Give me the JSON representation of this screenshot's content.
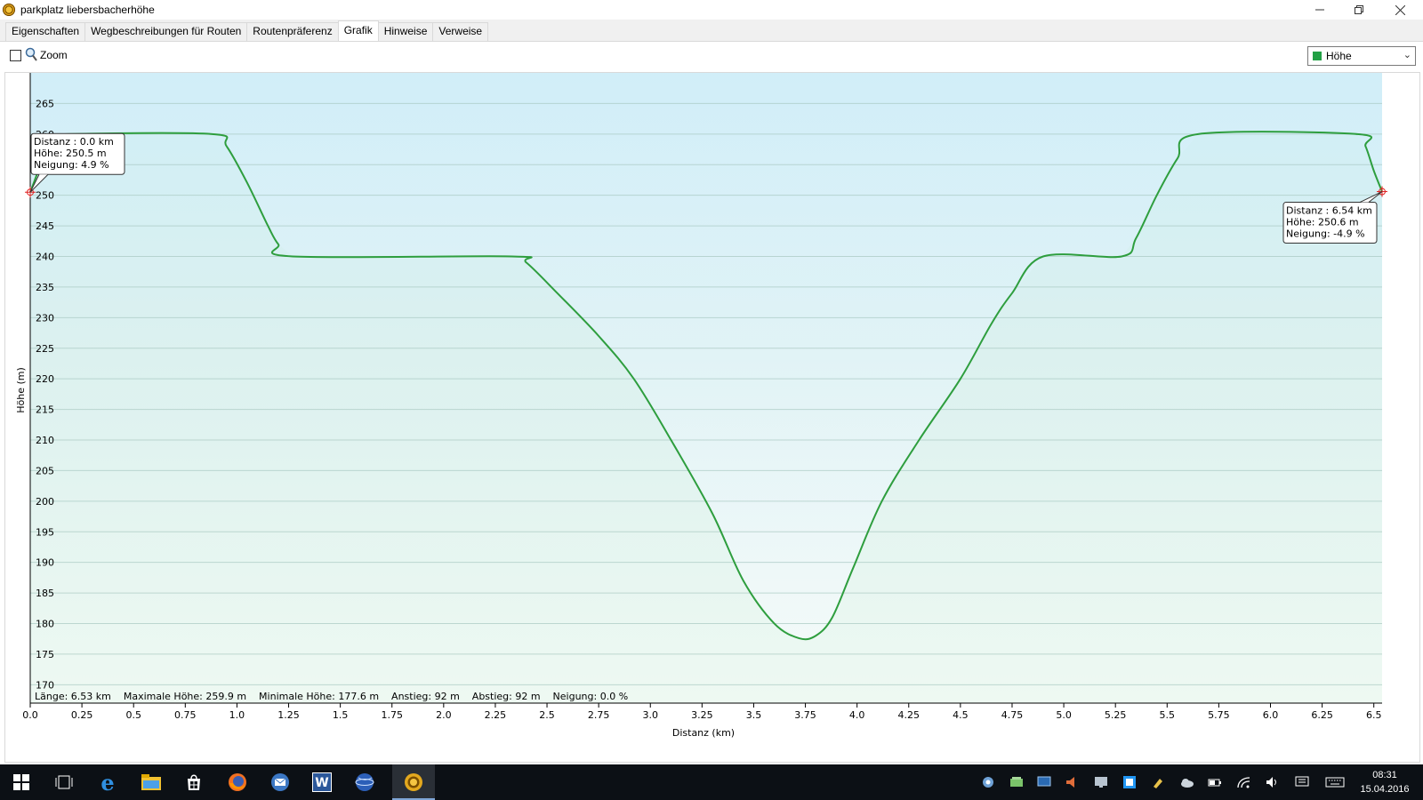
{
  "window": {
    "title": "parkplatz liebersbacherhöhe"
  },
  "tabs": [
    {
      "label": "Eigenschaften",
      "active": false
    },
    {
      "label": "Wegbeschreibungen für Routen",
      "active": false
    },
    {
      "label": "Routenpräferenz",
      "active": false
    },
    {
      "label": "Grafik",
      "active": true
    },
    {
      "label": "Hinweise",
      "active": false
    },
    {
      "label": "Verweise",
      "active": false
    }
  ],
  "toolbar": {
    "zoom_label": "Zoom",
    "zoom_checked": false,
    "series_select": {
      "value": "Höhe",
      "color": "#22a045"
    }
  },
  "chart_data": {
    "type": "area",
    "title": "",
    "xlabel": "Distanz  (km)",
    "ylabel": "Höhe (m)",
    "xlim": [
      0,
      6.54
    ],
    "ylim": [
      167,
      270
    ],
    "grid": true,
    "legend": "none",
    "line_color": "#2e9e3e",
    "x_ticks": [
      "0.0",
      "0.25",
      "0.5",
      "0.75",
      "1.0",
      "1.25",
      "1.5",
      "1.75",
      "2.0",
      "2.25",
      "2.5",
      "2.75",
      "3.0",
      "3.25",
      "3.5",
      "3.75",
      "4.0",
      "4.25",
      "4.5",
      "4.75",
      "5.0",
      "5.25",
      "5.5",
      "5.75",
      "6.0",
      "6.25",
      "6.5"
    ],
    "y_ticks": [
      "265",
      "260",
      "255",
      "250",
      "245",
      "240",
      "235",
      "230",
      "225",
      "220",
      "215",
      "210",
      "205",
      "200",
      "195",
      "190",
      "185",
      "180",
      "175",
      "170"
    ],
    "series": [
      {
        "x": [
          0.0,
          0.08,
          0.12,
          0.18,
          0.88,
          0.95,
          1.05,
          1.15,
          1.2,
          1.27,
          2.33,
          2.4,
          2.55,
          2.75,
          2.92,
          3.1,
          3.3,
          3.45,
          3.6,
          3.72,
          3.8,
          3.88,
          3.98,
          4.12,
          4.3,
          4.5,
          4.65,
          4.75,
          4.9,
          5.28,
          5.35,
          5.45,
          5.55,
          5.65,
          6.42,
          6.46,
          6.5,
          6.54
        ],
        "values": [
          250.5,
          257.5,
          259.5,
          260.0,
          260.0,
          258.0,
          252.0,
          245.0,
          242.0,
          240.0,
          240.0,
          239.0,
          234.0,
          227.0,
          220.0,
          210.0,
          198.0,
          187.0,
          180.0,
          177.6,
          178.0,
          181.0,
          189.0,
          200.0,
          210.0,
          220.0,
          229.0,
          234.0,
          240.0,
          240.0,
          243.0,
          250.0,
          256.0,
          260.0,
          260.0,
          258.0,
          254.0,
          250.6
        ]
      }
    ],
    "summary": "Länge: 6.53 km    Maximale Höhe: 259.9 m    Minimale Höhe: 177.6 m    Anstieg: 92 m    Abstieg: 92 m    Neigung: 0.0 %",
    "annotations": [
      {
        "x": 0.0,
        "y": 250.5,
        "lines": [
          "Distanz  : 0.0 km",
          "Höhe: 250.5 m",
          "Neigung: 4.9 %"
        ]
      },
      {
        "x": 6.54,
        "y": 250.6,
        "lines": [
          "Distanz  : 6.54 km",
          "Höhe: 250.6 m",
          "Neigung: -4.9 %"
        ]
      }
    ]
  },
  "taskbar": {
    "apps": [
      "start-icon",
      "task-view-icon",
      "edge-icon",
      "file-explorer-icon",
      "store-icon",
      "firefox-icon",
      "mail-icon",
      "word-icon",
      "globe-icon",
      "navigation-app-icon"
    ],
    "clock_time": "08:31",
    "clock_date": "15.04.2016"
  }
}
